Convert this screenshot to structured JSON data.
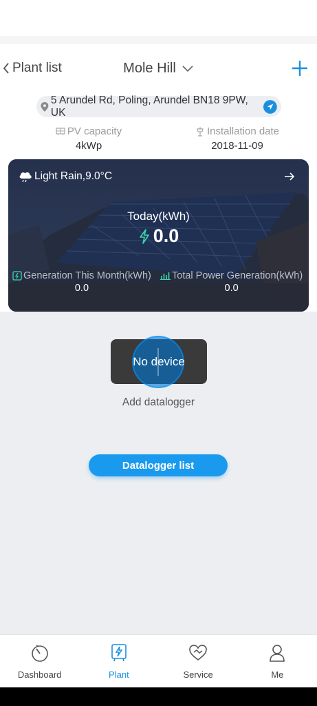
{
  "header": {
    "back_label": "Plant list",
    "plant_name": "Mole Hill"
  },
  "address": "5 Arundel Rd, Poling, Arundel BN18 9PW, UK",
  "info": {
    "pv_capacity_label": "PV capacity",
    "pv_capacity_value": "4kWp",
    "install_date_label": "Installation date",
    "install_date_value": "2018-11-09"
  },
  "card": {
    "weather": "Light Rain,9.0°C",
    "today_label": "Today(kWh)",
    "today_value": "0.0",
    "month_label": "Generation This Month(kWh)",
    "month_value": "0.0",
    "total_label": "Total Power Generation(kWh)",
    "total_value": "0.0"
  },
  "main": {
    "toast": "No device",
    "add_datalogger": "Add datalogger",
    "datalogger_list_button": "Datalogger list"
  },
  "tabs": [
    {
      "label": "Dashboard",
      "icon": "dashboard-icon"
    },
    {
      "label": "Plant",
      "icon": "plant-icon"
    },
    {
      "label": "Service",
      "icon": "service-icon"
    },
    {
      "label": "Me",
      "icon": "me-icon"
    }
  ],
  "colors": {
    "accent": "#1a9aee",
    "active_tab": "#1a8fe0",
    "lightning": "#3ad9b0"
  }
}
